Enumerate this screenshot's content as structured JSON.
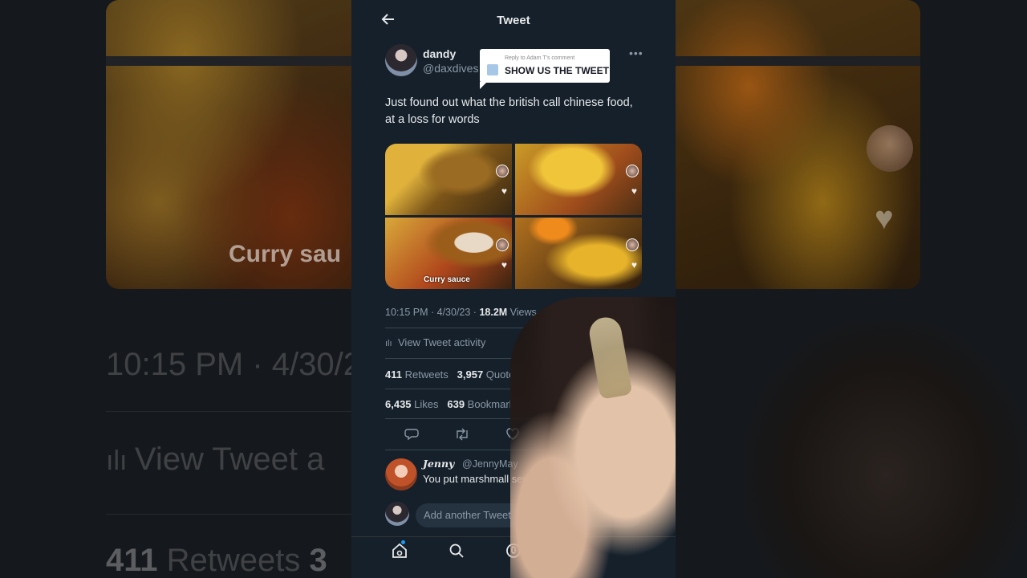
{
  "background": {
    "caption": "Curry sau",
    "timestamp": "10:15 PM · 4/30/2",
    "activity": "View Tweet a",
    "retweets_count": "411",
    "retweets_label": "Retweets",
    "quotes_partial": "3"
  },
  "header": {
    "title": "Tweet"
  },
  "author": {
    "name": "dandy",
    "handle": "@daxdives"
  },
  "reply_sticker": {
    "meta": "Reply to Adam T's comment",
    "text": "SHOW US THE TWEET"
  },
  "tweet": {
    "text": "Just found out what the british call chinese food, at a loss for words",
    "media_caption": "Curry sauce",
    "time": "10:15 PM · 4/30/23 · ",
    "views_count": "18.2M",
    "views_label": " Views"
  },
  "activity_label": "View Tweet activity",
  "stats": {
    "retweets_count": "411",
    "retweets_label": " Retweets",
    "quotes_count": "3,957",
    "quotes_label": " Quotes",
    "likes_count": "6,435",
    "likes_label": " Likes",
    "bookmarks_count": "639",
    "bookmarks_label": " Bookmarks"
  },
  "reply": {
    "name": "Jenny",
    "handle": "@JennyMay",
    "text": "You put marshmall serve it as a side d"
  },
  "compose": {
    "placeholder": "Add another Tweet"
  }
}
